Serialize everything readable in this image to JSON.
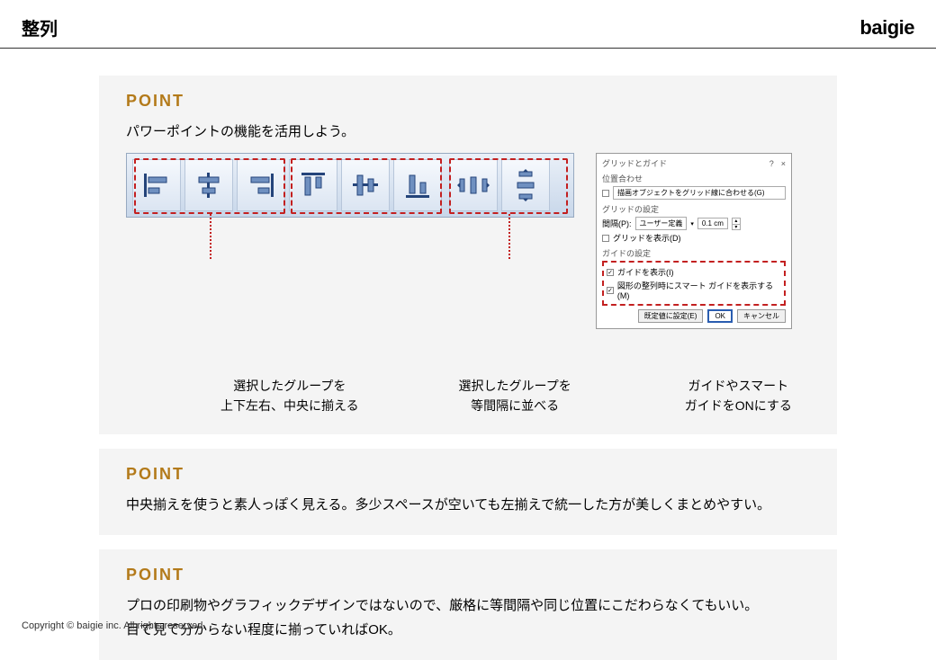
{
  "header": {
    "title": "整列",
    "brand": "baigie"
  },
  "point_label": "POINT",
  "section1": {
    "intro": "パワーポイントの機能を活用しよう。",
    "caption_align": "選択したグループを\n上下左右、中央に揃える",
    "caption_distribute": "選択したグループを\n等間隔に並べる",
    "caption_guide": "ガイドやスマート\nガイドをONにする"
  },
  "dialog": {
    "title": "グリッドとガイド",
    "help": "?",
    "close": "×",
    "sec_snap": "位置合わせ",
    "snap_to_grid": "描画オブジェクトをグリッド線に合わせる(G)",
    "sec_grid": "グリッドの設定",
    "spacing_label": "間隔(P):",
    "spacing_select": "ユーザー定義",
    "spacing_value": "0.1 cm",
    "show_grid": "グリッドを表示(D)",
    "sec_guide": "ガイドの設定",
    "show_guide": "ガイドを表示(I)",
    "smart_guide": "図形の整列時にスマート ガイドを表示する(M)",
    "btn_default": "既定値に設定(E)",
    "btn_ok": "OK",
    "btn_cancel": "キャンセル"
  },
  "section2": {
    "body": "中央揃えを使うと素人っぽく見える。多少スペースが空いても左揃えで統一した方が美しくまとめやすい。"
  },
  "section3": {
    "line1": "プロの印刷物やグラフィックデザインではないので、厳格に等間隔や同じ位置にこだわらなくてもいい。",
    "line2": "目で見て分からない程度に揃っていればOK。"
  },
  "footer": "Copyright © baigie inc. All rights reserved."
}
